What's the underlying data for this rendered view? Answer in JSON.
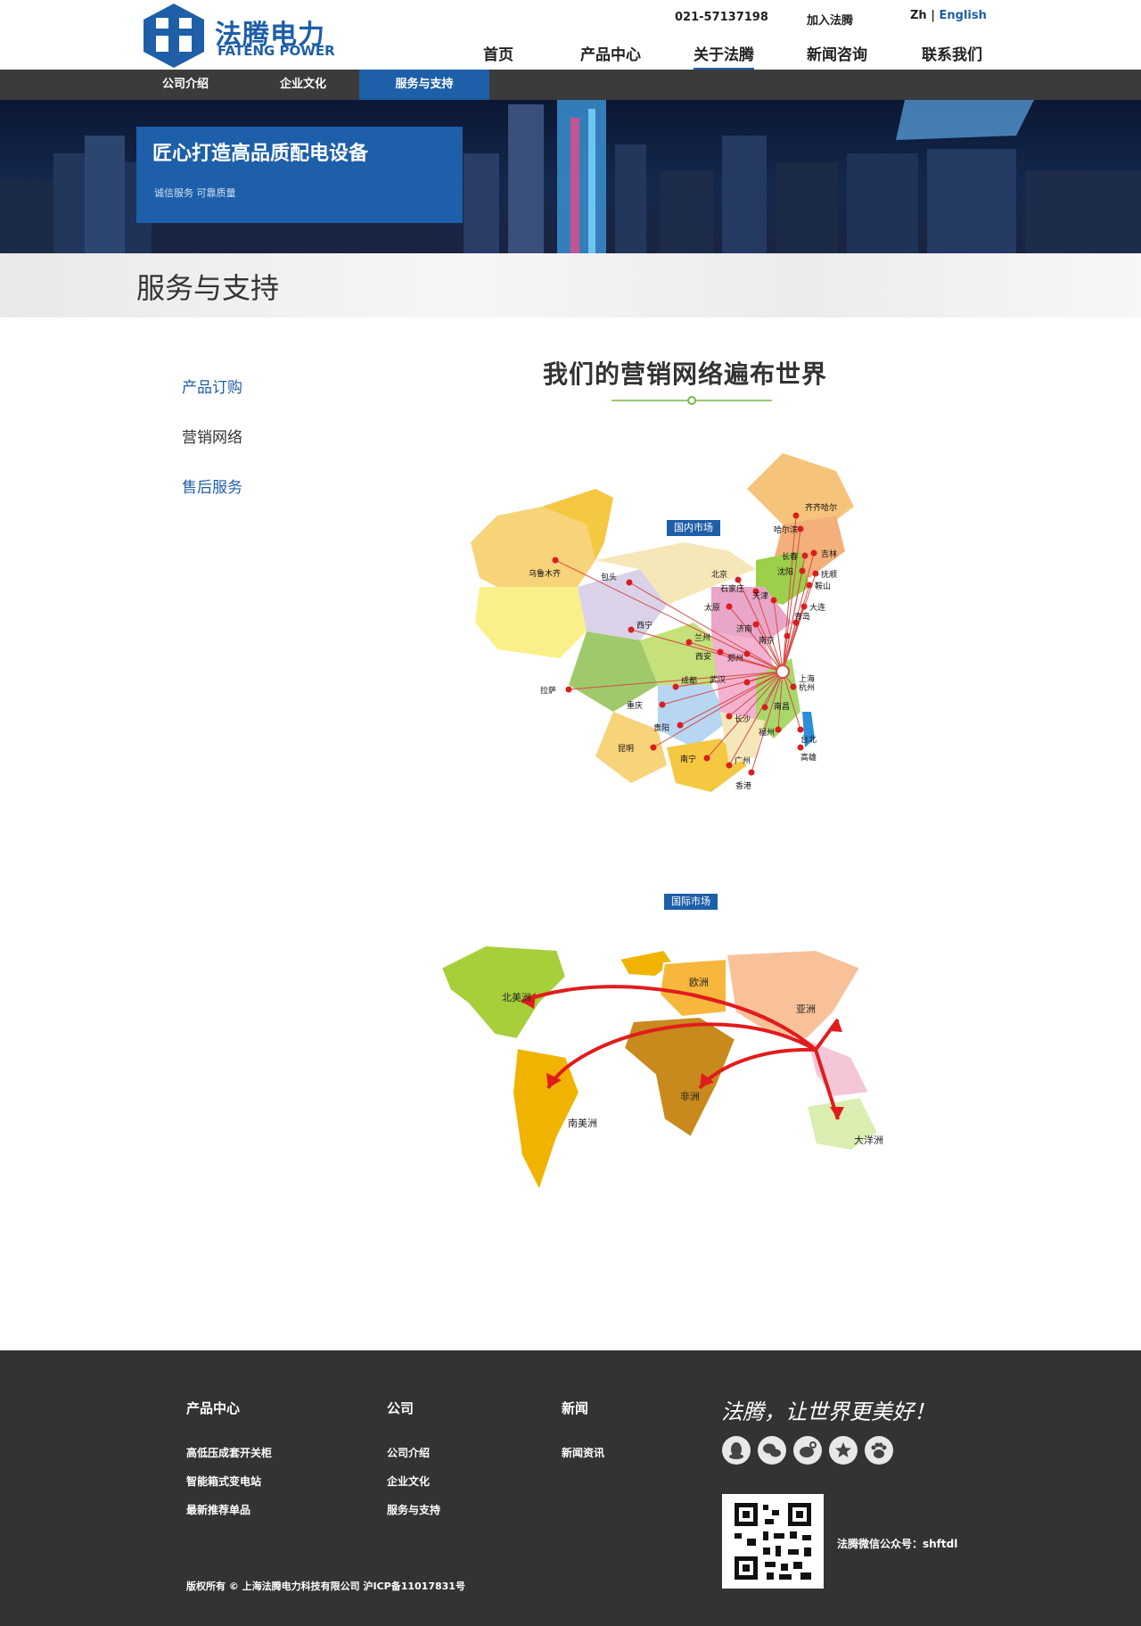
{
  "header": {
    "logo_cn": "法腾电力",
    "logo_en": "FATENG POWER",
    "phone": "021-57137198",
    "join": "加入法腾",
    "lang_zh": "Zh",
    "lang_sep": "|",
    "lang_en": "English",
    "nav": [
      "首页",
      "产品中心",
      "关于法腾",
      "新闻咨询",
      "联系我们"
    ]
  },
  "subnav": [
    "公司介绍",
    "企业文化",
    "服务与支持"
  ],
  "banner": {
    "title": "匠心打造高品质配电设备",
    "tags": "诚信服务    可靠质量"
  },
  "page_title": "服务与支持",
  "side_menu": [
    "产品订购",
    "营销网络",
    "售后服务"
  ],
  "main": {
    "heading": "我们的营销网络遍布世界",
    "domestic_tag": "国内市场",
    "international_tag": "国际市场",
    "china_cities": [
      "齐齐哈尔",
      "哈尔滨",
      "长春",
      "吉林",
      "沈阳",
      "抚顺",
      "鞍山",
      "大连",
      "乌鲁木齐",
      "包头",
      "北京",
      "石家庄",
      "天津",
      "太原",
      "济南",
      "青岛",
      "西宁",
      "兰州",
      "西安",
      "郑州",
      "南京",
      "上海",
      "杭州",
      "拉萨",
      "成都",
      "武汉",
      "重庆",
      "贵阳",
      "长沙",
      "南昌",
      "福州",
      "台北",
      "昆明",
      "南宁",
      "广州",
      "高雄",
      "香港"
    ],
    "continents": [
      "北美洲",
      "欧洲",
      "亚洲",
      "非洲",
      "南美洲",
      "大洋洲"
    ]
  },
  "footer": {
    "col1_title": "产品中心",
    "col1_links": [
      "高低压成套开关柜",
      "智能箱式变电站",
      "最新推荐单品"
    ],
    "col2_title": "公司",
    "col2_links": [
      "公司介绍",
      "企业文化",
      "服务与支持"
    ],
    "col3_title": "新闻",
    "col3_links": [
      "新闻资讯"
    ],
    "slogan": "法腾，让世界更美好！",
    "wechat": "法腾微信公众号：shftdl",
    "copyright": "版权所有 © 上海法腾电力科技有限公司 沪ICP备11017831号",
    "social_icons": [
      "qq-icon",
      "wechat-icon",
      "weibo-icon",
      "star-icon",
      "paw-icon"
    ]
  },
  "colors": {
    "brand_blue": "#1d5fa9",
    "dark_bar": "#3b3b3b",
    "footer_bg": "#333333",
    "accent_green": "#7ab648"
  }
}
